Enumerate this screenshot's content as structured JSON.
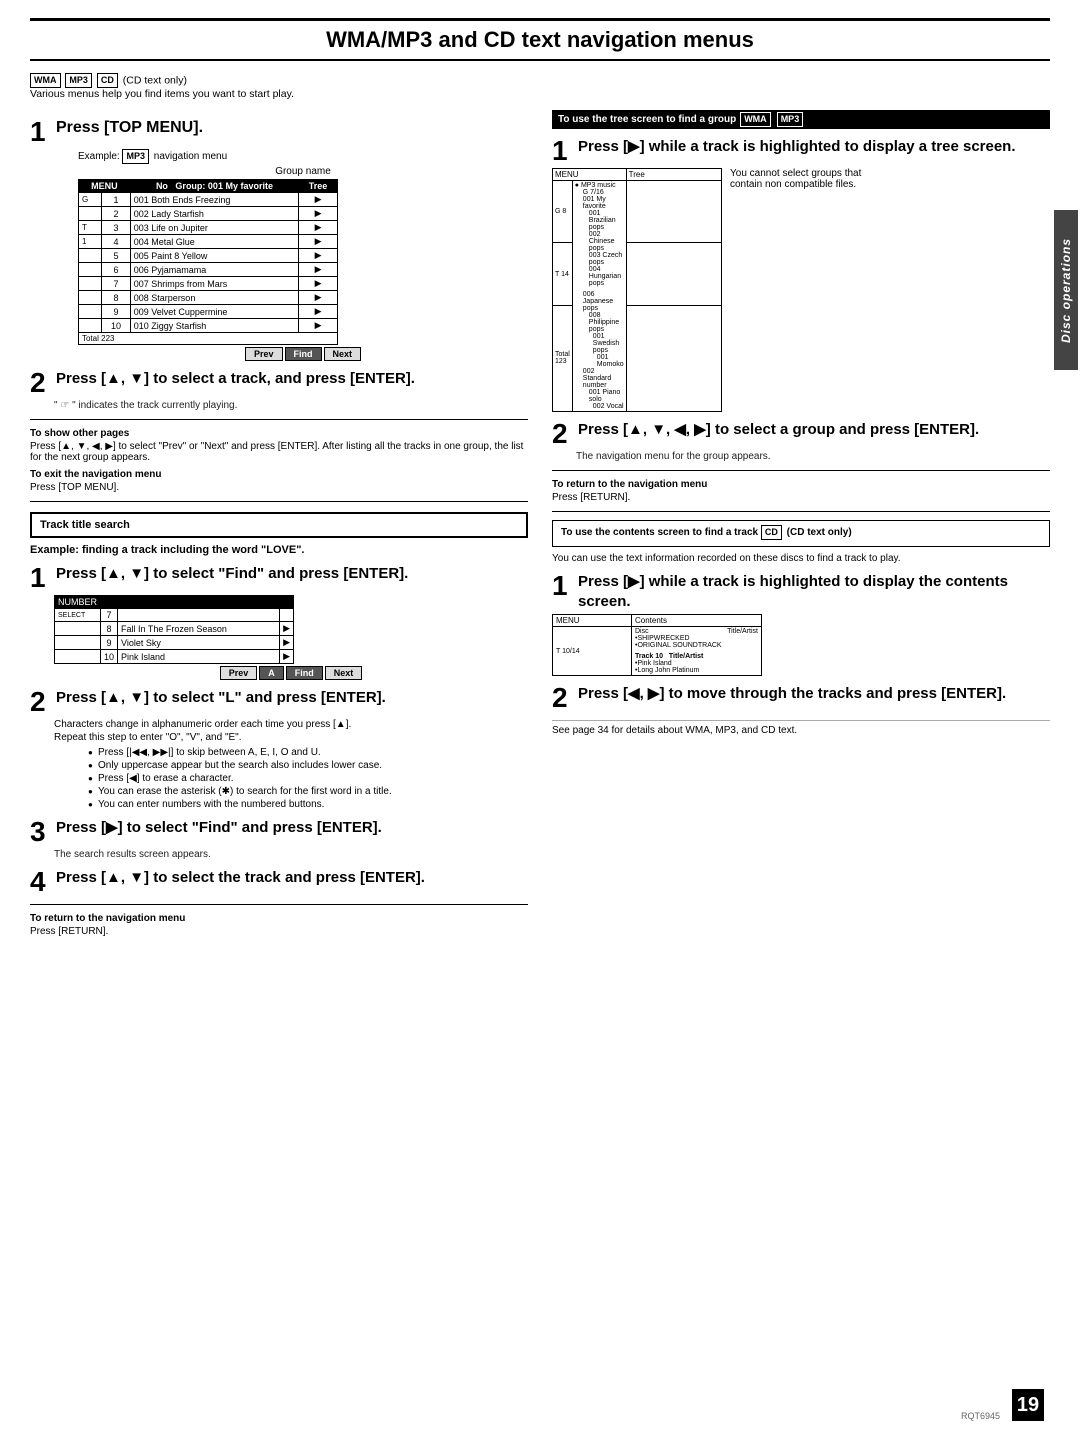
{
  "page": {
    "title": "WMA/MP3 and CD text navigation menus",
    "page_number": "19",
    "rqt_code": "RQT6945",
    "disc_ops_label": "Disc operations"
  },
  "header": {
    "badges": [
      "WMA",
      "MP3",
      "CD"
    ],
    "badge_note": "(CD text only)",
    "intro": "Various menus help you find items you want to start play."
  },
  "left": {
    "step1": {
      "num": "1",
      "text": "Press [TOP MENU].",
      "example": "Example:",
      "badge": "MP3",
      "example_rest": "navigation menu",
      "group_name_label": "Group name"
    },
    "nav_table": {
      "headers": [
        "MENU",
        "No",
        "Group: 001 My favorite",
        "Tree"
      ],
      "rows": [
        {
          "left": "G",
          "num": "1",
          "group": "001 Both Ends Freezing",
          "arr": "▶"
        },
        {
          "left": "",
          "num": "2",
          "group": "002 Lady Starfish",
          "arr": "▶"
        },
        {
          "left": "T",
          "num": "3",
          "group": "003 Life on Jupiter",
          "arr": "▶"
        },
        {
          "left": "1",
          "num": "4",
          "group": "004 Metal Glue",
          "arr": "▶"
        },
        {
          "left": "",
          "num": "5",
          "group": "005 Paint 8 Yellow",
          "arr": "▶"
        },
        {
          "left": "",
          "num": "6",
          "group": "006 Pyjamamama",
          "arr": "▶"
        },
        {
          "left": "",
          "num": "7",
          "group": "007 Shrimps from Mars",
          "arr": "▶"
        },
        {
          "left": "",
          "num": "8",
          "group": "008 Starperson",
          "arr": "▶"
        },
        {
          "left": "",
          "num": "9",
          "group": "009 Velvet Cuppermine",
          "arr": "▶"
        },
        {
          "left": "",
          "num": "10",
          "group": "010 Ziggy Starfish",
          "arr": "▶"
        }
      ],
      "footer_left": "Total 223",
      "buttons": [
        "Prev",
        "Find",
        "Next"
      ]
    },
    "step2": {
      "num": "2",
      "text": "Press [▲, ▼] to select a track, and press [ENTER].",
      "sub": "\" ☞ \" indicates the track currently playing."
    },
    "notes": {
      "show_other_pages_title": "To show other pages",
      "show_other_pages_body": "Press [▲, ▼, ◀, ▶] to select \"Prev\" or \"Next\" and press [ENTER]. After listing all the tracks in one group, the list for the next group appears.",
      "exit_title": "To exit the navigation menu",
      "exit_body": "Press [TOP MENU]."
    },
    "track_search_box": "Track title search",
    "example_bold": "Example: finding a track including the word \"LOVE\".",
    "search_step1": {
      "num": "1",
      "text": "Press [▲, ▼] to select \"Find\" and press [ENTER]."
    },
    "find_table": {
      "headers": [
        "NUMBER",
        "",
        ""
      ],
      "rows": [
        {
          "sel": "SELECT",
          "num": "7",
          "track": ""
        },
        {
          "sel": "",
          "num": "8",
          "track": "Fall In The Frozen Season",
          "arr": "▶"
        },
        {
          "sel": "",
          "num": "9",
          "track": "Violet Sky",
          "arr": "▶"
        },
        {
          "sel": "",
          "num": "10",
          "track": "Pink Island",
          "arr": "▶"
        }
      ],
      "buttons": [
        "Prev",
        "A",
        "Find",
        "Next"
      ]
    },
    "search_step2": {
      "num": "2",
      "text": "Press [▲, ▼] to select \"L\" and press [ENTER].",
      "body1": "Characters change in alphanumeric order each time you press [▲].",
      "body2": "Repeat this step to enter \"O\", \"V\", and \"E\".",
      "bullets": [
        "Press [|◀◀, ▶▶|] to skip between A, E, I, O and U.",
        "Only uppercase appear but the search also includes lower case.",
        "Press [◀] to erase a character.",
        "You can erase the asterisk (✱) to search for the first word in a title.",
        "You can enter numbers with the numbered buttons."
      ]
    },
    "search_step3": {
      "num": "3",
      "text": "Press [▶] to select \"Find\" and press [ENTER].",
      "sub": "The search results screen appears."
    },
    "search_step4": {
      "num": "4",
      "text": "Press [▲, ▼] to select the track and press [ENTER]."
    },
    "return_note": {
      "title": "To return to the navigation menu",
      "body": "Press [RETURN]."
    }
  },
  "right": {
    "tree_header": "To use the tree screen to find a group",
    "tree_badges": [
      "WMA",
      "MP3"
    ],
    "step1": {
      "num": "1",
      "text": "Press [▶] while a track is highlighted to display a tree screen."
    },
    "tree_table": {
      "menu_label": "MENU",
      "tree_label": "Tree",
      "g_val": "G 8",
      "t_val": "T 14",
      "total": "Total 123",
      "mp3_label": "● MP3 music",
      "g_ref": "G 7/16",
      "items": [
        "001 My favorite",
        "001 Brazilian pops",
        "002 Chinese pops",
        "003 Czech pops",
        "004 Hungarian pops",
        "",
        "006 Japanese pops",
        "008 Philippine pops",
        "001 Swedish pops",
        "001 Momoko",
        "002 Standard number",
        "001 Piano solo",
        "002 Vocal"
      ]
    },
    "tree_note": "You cannot select groups that contain non compatible files.",
    "step2": {
      "num": "2",
      "text": "Press [▲, ▼, ◀, ▶] to select a group and press [ENTER].",
      "sub": "The navigation menu for the group appears."
    },
    "return_note": {
      "title": "To return to the navigation menu",
      "body": "Press [RETURN]."
    },
    "contents_header": "To use the contents screen to find a track",
    "contents_badge": "CD",
    "contents_note": "(CD text only)",
    "contents_intro": "You can use the text information recorded on these discs to find a track to play.",
    "step1b": {
      "num": "1",
      "text": "Press [▶] while a track is highlighted to display the contents screen."
    },
    "contents_table": {
      "menu_label": "MENU",
      "contents_label": "Contents",
      "t_val": "T 10/14",
      "disc_header": "Disc",
      "title_artist_header": "Title/Artist",
      "items": [
        "•SHIPWRECKED",
        "•ORIGINAL SOUNDTRACK",
        "Track 10",
        "Title/Artist",
        "•Pink Island",
        "•Long John Platinum"
      ]
    },
    "step2b": {
      "num": "2",
      "text": "Press [◀, ▶] to move through the tracks and press [ENTER]."
    },
    "bottom_note": "See page 34 for details about WMA, MP3, and CD text."
  }
}
